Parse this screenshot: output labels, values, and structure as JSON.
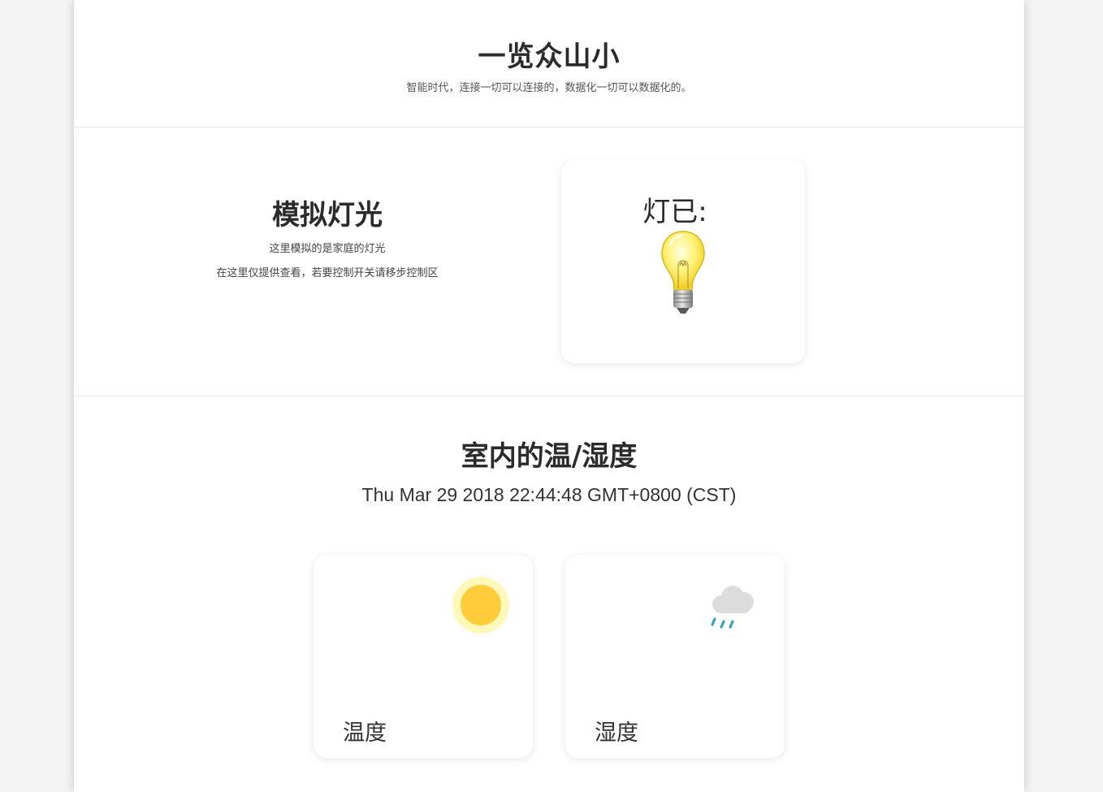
{
  "header": {
    "title": "一览众山小",
    "subtitle": "智能时代，连接一切可以连接的，数据化一切可以数据化的。"
  },
  "light": {
    "title": "模拟灯光",
    "description_1": "这里模拟的是家庭的灯光",
    "description_2": "在这里仅提供查看，若要控制开关请移步控制区",
    "status_label": "灯已:",
    "status_icon": "lightbulb-icon",
    "bulb_color": "#fff59a"
  },
  "climate": {
    "title": "室内的温/湿度",
    "timestamp": "Thu Mar 29 2018 22:44:48 GMT+0800 (CST)",
    "cards": [
      {
        "label": "温度",
        "icon": "sun-icon",
        "color": "#ffcd3c"
      },
      {
        "label": "湿度",
        "icon": "rain-cloud-icon",
        "color": "#2aa3b5"
      }
    ]
  }
}
